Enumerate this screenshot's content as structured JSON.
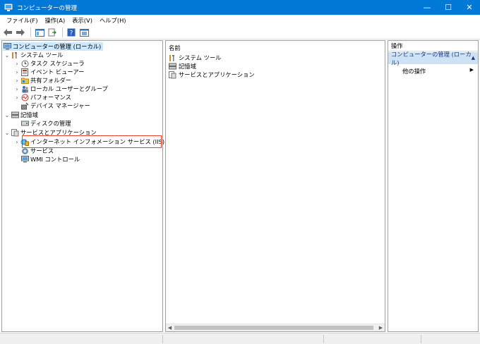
{
  "window": {
    "title": "コンピューターの管理",
    "controls": {
      "minimize": "—",
      "maximize": "☐",
      "close": "✕"
    }
  },
  "menu": [
    "ファイル(F)",
    "操作(A)",
    "表示(V)",
    "ヘルプ(H)"
  ],
  "toolbar": {
    "icons": [
      "back-arrow-icon",
      "forward-arrow-icon",
      "show-hide-tree-icon",
      "export-list-icon",
      "help-icon",
      "properties-icon"
    ]
  },
  "tree": {
    "root": "コンピューターの管理 (ローカル)",
    "system_tools": "システム ツール",
    "task_scheduler": "タスク スケジューラ",
    "event_viewer": "イベント ビューアー",
    "shared_folders": "共有フォルダー",
    "local_users": "ローカル ユーザーとグループ",
    "performance": "パフォーマンス",
    "device_manager": "デバイス マネージャー",
    "storage": "記憶域",
    "disk_management": "ディスクの管理",
    "services_apps": "サービスとアプリケーション",
    "iis_manager": "インターネット インフォメーション サービス (IIS) マネージャー",
    "services": "サービス",
    "wmi_control": "WMI コントロール"
  },
  "list": {
    "header": "名前",
    "items": [
      "システム ツール",
      "記憶域",
      "サービスとアプリケーション"
    ]
  },
  "actions": {
    "title": "操作",
    "section": "コンピューターの管理 (ローカル)",
    "other": "他の操作"
  }
}
